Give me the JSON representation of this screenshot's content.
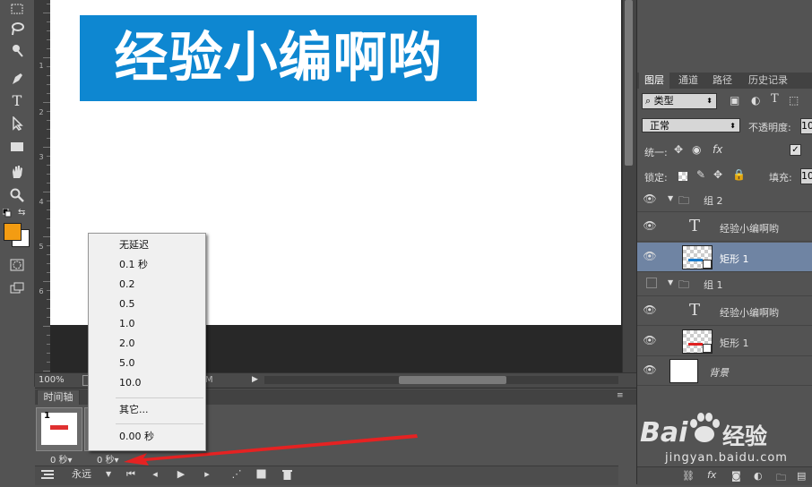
{
  "toolbar": {
    "tools": [
      "marquee-tool-icon",
      "lasso-tool-icon",
      "quick-select-tool-icon",
      "pen-tool-icon",
      "type-tool-icon",
      "path-select-tool-icon",
      "rectangle-tool-icon",
      "hand-tool-icon",
      "zoom-tool-icon"
    ],
    "type_tool_glyph": "T",
    "foreground_color": "#f39c12",
    "background_color": "#ffffff"
  },
  "ruler": {
    "labels": [
      "1",
      "2",
      "3",
      "4",
      "5",
      "6"
    ]
  },
  "canvas": {
    "banner_text": "经验小编啊哟",
    "banner_color": "#0e87d1"
  },
  "statusbar": {
    "zoom": "100%",
    "doc_info": "M"
  },
  "timeline": {
    "tab_label": "时间轴",
    "frames": [
      {
        "number": "1",
        "delay": "0 秒▾"
      },
      {
        "number": "2",
        "delay": "0 秒▾"
      }
    ],
    "loop_label": "永远",
    "delay_menu": {
      "items": [
        "无延迟",
        "0.1 秒",
        "0.2",
        "0.5",
        "1.0",
        "2.0",
        "5.0",
        "10.0"
      ],
      "other": "其它...",
      "current": "0.00 秒"
    }
  },
  "layers_panel": {
    "tabs": [
      "图层",
      "通道",
      "路径",
      "历史记录"
    ],
    "filter_kind": "类型",
    "blend_mode": "正常",
    "opacity_label": "不透明度:",
    "opacity_value": "10",
    "unify_label": "统一:",
    "lock_label": "锁定:",
    "fill_label": "填充:",
    "fill_value": "10",
    "layers": [
      {
        "name": "组 2",
        "kind": "group",
        "visible": true
      },
      {
        "name": "经验小编啊哟",
        "kind": "text",
        "visible": true
      },
      {
        "name": "矩形 1",
        "kind": "shape",
        "visible": true,
        "selected": true
      },
      {
        "name": "组 1",
        "kind": "group",
        "visible": false
      },
      {
        "name": "经验小编啊哟",
        "kind": "text",
        "visible": true
      },
      {
        "name": "矩形 1",
        "kind": "shape",
        "visible": true
      },
      {
        "name": "背景",
        "kind": "background",
        "visible": true
      }
    ]
  },
  "watermark": {
    "brand": "Bai",
    "brand2": "经验",
    "url": "jingyan.baidu.com"
  }
}
